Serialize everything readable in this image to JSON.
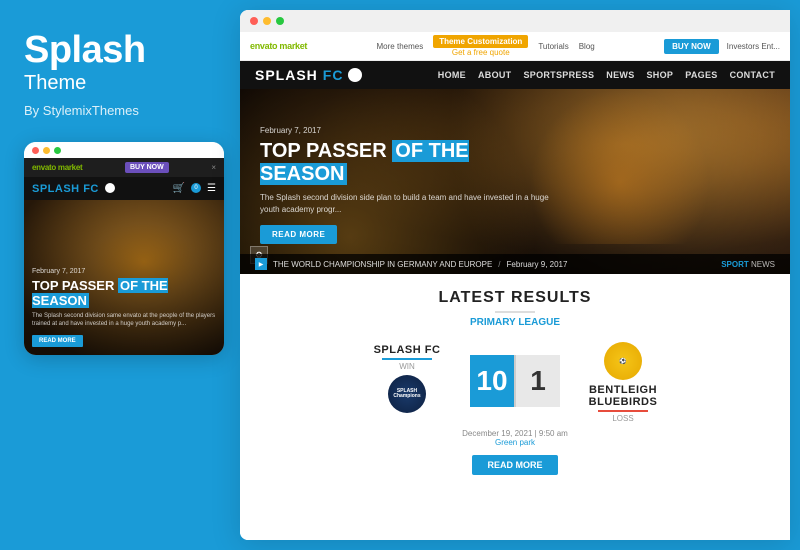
{
  "leftPanel": {
    "title": "Splash",
    "subtitle": "Theme",
    "author": "By StylemixThemes"
  },
  "mobileMockup": {
    "topBar": {
      "dots": [
        "red",
        "yellow",
        "green"
      ]
    },
    "envatoBar": {
      "logo": "envato market",
      "buyNow": "BUY NOW",
      "close": "×"
    },
    "header": {
      "logoSplash": "SPLASH",
      "logoFc": "FC",
      "cartCount": "0"
    },
    "hero": {
      "date": "February 7, 2017",
      "headlinePart1": "TOP PASSER",
      "headlinePart2": "OF THE SEASON",
      "description": "The Splash second division same envato at the people of the players trained at and have invested in a huge youth academy p...",
      "readMore": "READ MORE"
    }
  },
  "desktopMockup": {
    "envatoBar": {
      "logo": "envato market",
      "moreThemes": "More themes",
      "themeCustomization": "Theme Customization",
      "themeCustomizationSub": "Get a free quote",
      "tutorials": "Tutorials",
      "blog": "Blog",
      "buyNow": "BUY NOW",
      "moreLabel": "Investors Ent..."
    },
    "header": {
      "logoSplash": "SPLASH",
      "logoFc": "FC",
      "nav": [
        "HOME",
        "ABOUT",
        "SPORTSPRESS",
        "NEWS",
        "SHOP",
        "PAGES",
        "CONTACT"
      ]
    },
    "hero": {
      "date": "February 7, 2017",
      "headlinePart1": "TOP PASSER",
      "headlinePart2": "OF THE SEASON",
      "description": "The Splash second division side plan to build a team and have invested in a huge youth academy progr...",
      "readMore": "READ MORE",
      "bottomText": "THE WORLD CHAMPIONSHIP IN GERMANY AND EUROPE",
      "bottomDate": "February 9, 2017",
      "sportTag": "SPORT",
      "newsTag": "NEWS"
    },
    "latestResults": {
      "title": "LATEST RESULTS",
      "league": "Primary League",
      "teamLeft": {
        "name": "SPLASH FC",
        "status": "WIN"
      },
      "teamRight": {
        "name": "BENTLEIGH BLUEBIRDS",
        "status": "LOSS"
      },
      "scoreLeft": "10",
      "scoreRight": "1",
      "matchDate": "December 19, 2021 | 9:50 am",
      "matchVenue": "Green park",
      "readMore": "READ MORE"
    }
  }
}
